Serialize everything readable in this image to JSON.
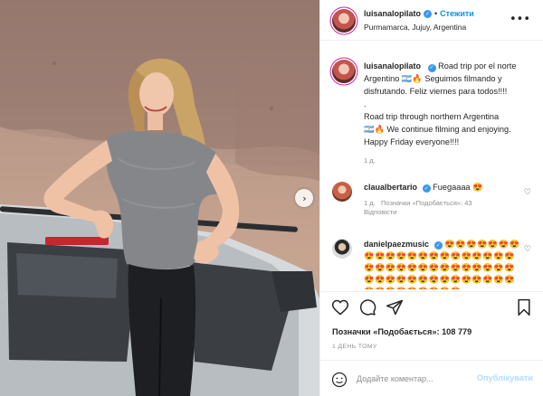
{
  "header": {
    "username": "luisanalopilato",
    "separator": "•",
    "follow_label": "Стежити",
    "location": "Purmamarca, Jujuy, Argentina",
    "more_icon": "more-horizontal-icon"
  },
  "caption": {
    "username": "luisanalopilato",
    "lines": [
      "Road trip por el norte",
      "Argentino 🇦🇷🔥 Seguimos filmando y",
      "disfrutando. Feliz viernes para todos!!!!",
      ".",
      "Road trip through northern Argentina",
      "🇦🇷🔥 We continue filming and enjoying.",
      "Happy Friday everyone!!!!"
    ],
    "time": "1 д."
  },
  "comments": [
    {
      "username": "claualbertario",
      "text": "Fuegaaaa 😍",
      "time": "1 д.",
      "likes": "Позначки «Подобається»: 43",
      "reply": "Відповісти"
    },
    {
      "username": "danielpaezmusic",
      "text": "😍😍😍😍😍😍😍😍😍😍😍😍😍😍😍😍😍😍😍😍😍😍😍😍😍😍😍😍😍😍😍😍😍😍😍😍😍😍😍😍😍😍😍😍😍😍😍😍😍😍😍😍😍😍😍😍😍😍"
    }
  ],
  "likes_count": "Позначки «Подобається»: 108 779",
  "time_ago": "1 ДЕНЬ ТОМУ",
  "comment_input": {
    "placeholder": "Додайте коментар..."
  },
  "post_button": "Опублікувати",
  "colors": {
    "accent": "#0095f6",
    "verified": "#3897f0",
    "post_disabled": "#b3dbff"
  }
}
